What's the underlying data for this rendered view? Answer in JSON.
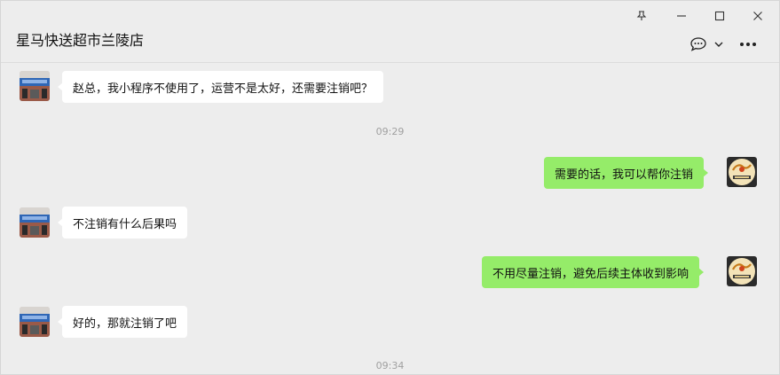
{
  "chat": {
    "title": "星马快送超市兰陵店"
  },
  "window_controls": {
    "pin": "pin-icon",
    "minimize": "minimize-icon",
    "maximize": "maximize-icon",
    "close": "close-icon"
  },
  "toolbar": {
    "chat_options": "chat-bubble-icon",
    "dropdown": "chevron-down-icon",
    "more": "more-icon"
  },
  "messages": [
    {
      "side": "in",
      "text": "赵总，我小程序不使用了，运营不是太好，还需要注销吧？"
    },
    {
      "side": "time",
      "text": "09:29"
    },
    {
      "side": "out",
      "text": "需要的话，我可以帮你注销"
    },
    {
      "side": "in",
      "text": "不注销有什么后果吗"
    },
    {
      "side": "out",
      "text": "不用尽量注销，避免后续主体收到影响"
    },
    {
      "side": "in",
      "text": "好的，那就注销了吧"
    },
    {
      "side": "time",
      "text": "09:34"
    }
  ],
  "colors": {
    "background": "#ededed",
    "outgoing_bubble": "#95ec69",
    "incoming_bubble": "#ffffff",
    "timestamp": "#a0a0a0"
  }
}
